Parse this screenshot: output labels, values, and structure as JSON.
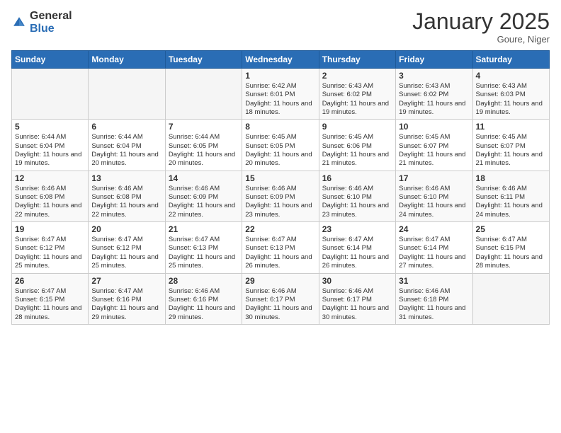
{
  "header": {
    "logo_general": "General",
    "logo_blue": "Blue",
    "month": "January 2025",
    "location": "Goure, Niger"
  },
  "weekdays": [
    "Sunday",
    "Monday",
    "Tuesday",
    "Wednesday",
    "Thursday",
    "Friday",
    "Saturday"
  ],
  "weeks": [
    [
      {
        "day": "",
        "sunrise": "",
        "sunset": "",
        "daylight": ""
      },
      {
        "day": "",
        "sunrise": "",
        "sunset": "",
        "daylight": ""
      },
      {
        "day": "",
        "sunrise": "",
        "sunset": "",
        "daylight": ""
      },
      {
        "day": "1",
        "sunrise": "Sunrise: 6:42 AM",
        "sunset": "Sunset: 6:01 PM",
        "daylight": "Daylight: 11 hours and 18 minutes."
      },
      {
        "day": "2",
        "sunrise": "Sunrise: 6:43 AM",
        "sunset": "Sunset: 6:02 PM",
        "daylight": "Daylight: 11 hours and 19 minutes."
      },
      {
        "day": "3",
        "sunrise": "Sunrise: 6:43 AM",
        "sunset": "Sunset: 6:02 PM",
        "daylight": "Daylight: 11 hours and 19 minutes."
      },
      {
        "day": "4",
        "sunrise": "Sunrise: 6:43 AM",
        "sunset": "Sunset: 6:03 PM",
        "daylight": "Daylight: 11 hours and 19 minutes."
      }
    ],
    [
      {
        "day": "5",
        "sunrise": "Sunrise: 6:44 AM",
        "sunset": "Sunset: 6:04 PM",
        "daylight": "Daylight: 11 hours and 19 minutes."
      },
      {
        "day": "6",
        "sunrise": "Sunrise: 6:44 AM",
        "sunset": "Sunset: 6:04 PM",
        "daylight": "Daylight: 11 hours and 20 minutes."
      },
      {
        "day": "7",
        "sunrise": "Sunrise: 6:44 AM",
        "sunset": "Sunset: 6:05 PM",
        "daylight": "Daylight: 11 hours and 20 minutes."
      },
      {
        "day": "8",
        "sunrise": "Sunrise: 6:45 AM",
        "sunset": "Sunset: 6:05 PM",
        "daylight": "Daylight: 11 hours and 20 minutes."
      },
      {
        "day": "9",
        "sunrise": "Sunrise: 6:45 AM",
        "sunset": "Sunset: 6:06 PM",
        "daylight": "Daylight: 11 hours and 21 minutes."
      },
      {
        "day": "10",
        "sunrise": "Sunrise: 6:45 AM",
        "sunset": "Sunset: 6:07 PM",
        "daylight": "Daylight: 11 hours and 21 minutes."
      },
      {
        "day": "11",
        "sunrise": "Sunrise: 6:45 AM",
        "sunset": "Sunset: 6:07 PM",
        "daylight": "Daylight: 11 hours and 21 minutes."
      }
    ],
    [
      {
        "day": "12",
        "sunrise": "Sunrise: 6:46 AM",
        "sunset": "Sunset: 6:08 PM",
        "daylight": "Daylight: 11 hours and 22 minutes."
      },
      {
        "day": "13",
        "sunrise": "Sunrise: 6:46 AM",
        "sunset": "Sunset: 6:08 PM",
        "daylight": "Daylight: 11 hours and 22 minutes."
      },
      {
        "day": "14",
        "sunrise": "Sunrise: 6:46 AM",
        "sunset": "Sunset: 6:09 PM",
        "daylight": "Daylight: 11 hours and 22 minutes."
      },
      {
        "day": "15",
        "sunrise": "Sunrise: 6:46 AM",
        "sunset": "Sunset: 6:09 PM",
        "daylight": "Daylight: 11 hours and 23 minutes."
      },
      {
        "day": "16",
        "sunrise": "Sunrise: 6:46 AM",
        "sunset": "Sunset: 6:10 PM",
        "daylight": "Daylight: 11 hours and 23 minutes."
      },
      {
        "day": "17",
        "sunrise": "Sunrise: 6:46 AM",
        "sunset": "Sunset: 6:10 PM",
        "daylight": "Daylight: 11 hours and 24 minutes."
      },
      {
        "day": "18",
        "sunrise": "Sunrise: 6:46 AM",
        "sunset": "Sunset: 6:11 PM",
        "daylight": "Daylight: 11 hours and 24 minutes."
      }
    ],
    [
      {
        "day": "19",
        "sunrise": "Sunrise: 6:47 AM",
        "sunset": "Sunset: 6:12 PM",
        "daylight": "Daylight: 11 hours and 25 minutes."
      },
      {
        "day": "20",
        "sunrise": "Sunrise: 6:47 AM",
        "sunset": "Sunset: 6:12 PM",
        "daylight": "Daylight: 11 hours and 25 minutes."
      },
      {
        "day": "21",
        "sunrise": "Sunrise: 6:47 AM",
        "sunset": "Sunset: 6:13 PM",
        "daylight": "Daylight: 11 hours and 25 minutes."
      },
      {
        "day": "22",
        "sunrise": "Sunrise: 6:47 AM",
        "sunset": "Sunset: 6:13 PM",
        "daylight": "Daylight: 11 hours and 26 minutes."
      },
      {
        "day": "23",
        "sunrise": "Sunrise: 6:47 AM",
        "sunset": "Sunset: 6:14 PM",
        "daylight": "Daylight: 11 hours and 26 minutes."
      },
      {
        "day": "24",
        "sunrise": "Sunrise: 6:47 AM",
        "sunset": "Sunset: 6:14 PM",
        "daylight": "Daylight: 11 hours and 27 minutes."
      },
      {
        "day": "25",
        "sunrise": "Sunrise: 6:47 AM",
        "sunset": "Sunset: 6:15 PM",
        "daylight": "Daylight: 11 hours and 28 minutes."
      }
    ],
    [
      {
        "day": "26",
        "sunrise": "Sunrise: 6:47 AM",
        "sunset": "Sunset: 6:15 PM",
        "daylight": "Daylight: 11 hours and 28 minutes."
      },
      {
        "day": "27",
        "sunrise": "Sunrise: 6:47 AM",
        "sunset": "Sunset: 6:16 PM",
        "daylight": "Daylight: 11 hours and 29 minutes."
      },
      {
        "day": "28",
        "sunrise": "Sunrise: 6:46 AM",
        "sunset": "Sunset: 6:16 PM",
        "daylight": "Daylight: 11 hours and 29 minutes."
      },
      {
        "day": "29",
        "sunrise": "Sunrise: 6:46 AM",
        "sunset": "Sunset: 6:17 PM",
        "daylight": "Daylight: 11 hours and 30 minutes."
      },
      {
        "day": "30",
        "sunrise": "Sunrise: 6:46 AM",
        "sunset": "Sunset: 6:17 PM",
        "daylight": "Daylight: 11 hours and 30 minutes."
      },
      {
        "day": "31",
        "sunrise": "Sunrise: 6:46 AM",
        "sunset": "Sunset: 6:18 PM",
        "daylight": "Daylight: 11 hours and 31 minutes."
      },
      {
        "day": "",
        "sunrise": "",
        "sunset": "",
        "daylight": ""
      }
    ]
  ]
}
